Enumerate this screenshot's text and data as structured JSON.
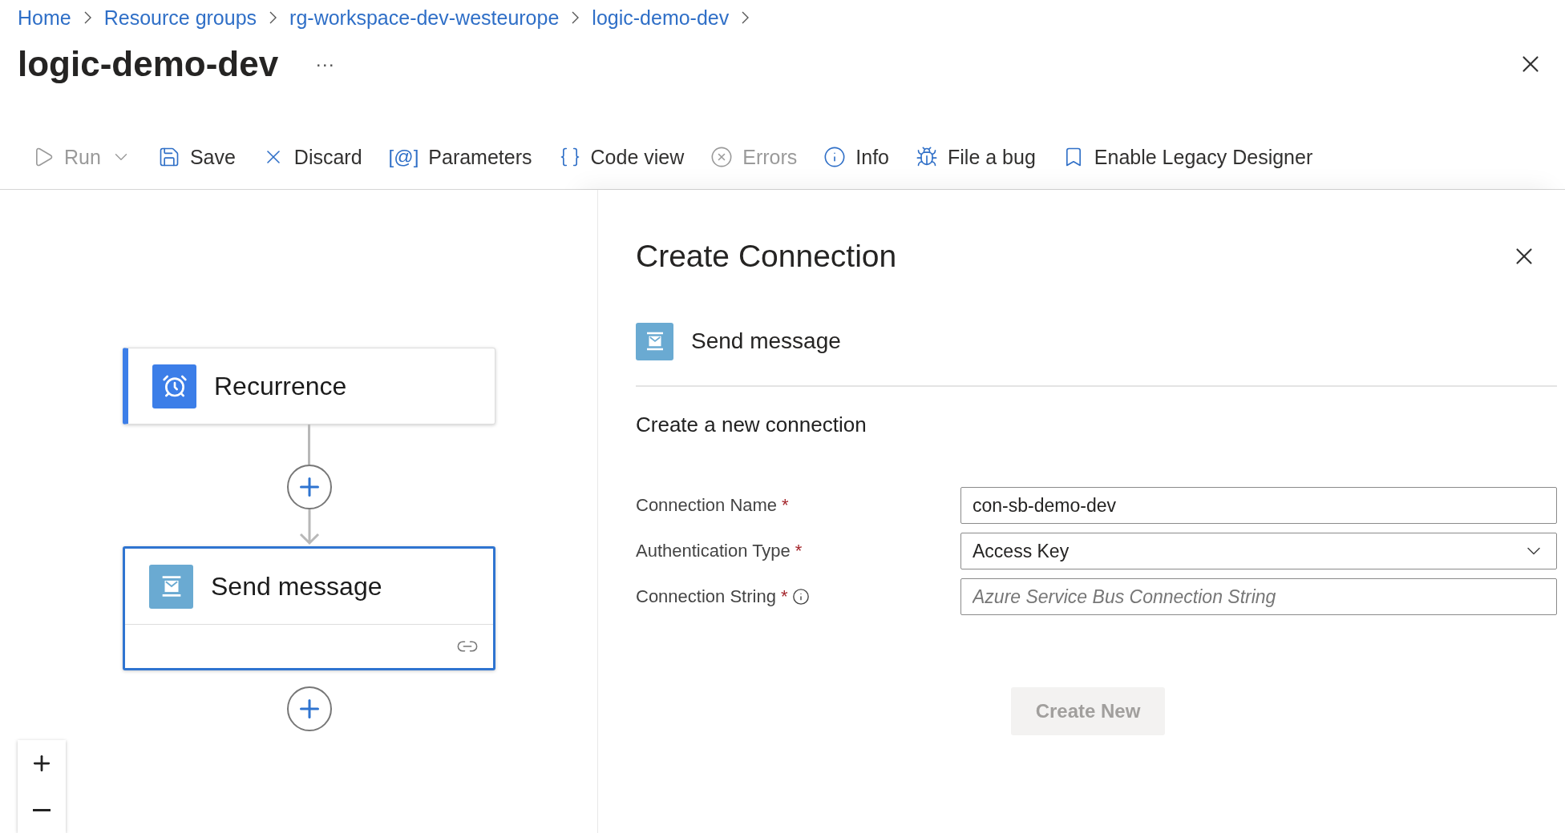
{
  "breadcrumb": [
    "Home",
    "Resource groups",
    "rg-workspace-dev-westeurope",
    "logic-demo-dev"
  ],
  "title": "logic-demo-dev",
  "more": "···",
  "toolbar": [
    {
      "label": "Run",
      "disabled": true,
      "dropdown": true
    },
    {
      "label": "Save",
      "disabled": false,
      "dropdown": false
    },
    {
      "label": "Discard",
      "disabled": false,
      "dropdown": false
    },
    {
      "label": "Parameters",
      "glyph": "[@]",
      "disabled": false,
      "dropdown": false
    },
    {
      "label": "Code view",
      "disabled": false,
      "dropdown": false
    },
    {
      "label": "Errors",
      "disabled": true,
      "dropdown": false
    },
    {
      "label": "Info",
      "disabled": false,
      "dropdown": false
    },
    {
      "label": "File a bug",
      "disabled": false,
      "dropdown": false
    },
    {
      "label": "Enable Legacy Designer",
      "disabled": false,
      "dropdown": false
    }
  ],
  "canvas": {
    "cards": [
      {
        "kind": "trigger",
        "title": "Recurrence",
        "selected": false,
        "color": "#3c7ee8"
      },
      {
        "kind": "action",
        "title": "Send message",
        "selected": true,
        "color": "#6aaad2"
      }
    ]
  },
  "panel": {
    "title": "Create Connection",
    "operation": "Send message",
    "section": "Create a new connection",
    "fields": [
      {
        "kind": "text",
        "label": "Connection Name",
        "required_mark": "*",
        "info": false,
        "value": "con-sb-demo-dev"
      },
      {
        "kind": "select",
        "label": "Authentication Type",
        "required_mark": "*",
        "info": false,
        "value": "Access Key"
      },
      {
        "kind": "text",
        "label": "Connection String",
        "required_mark": "*",
        "info": true,
        "placeholder": "Azure Service Bus Connection String"
      }
    ],
    "button": {
      "label": "Create New",
      "disabled": true
    }
  }
}
